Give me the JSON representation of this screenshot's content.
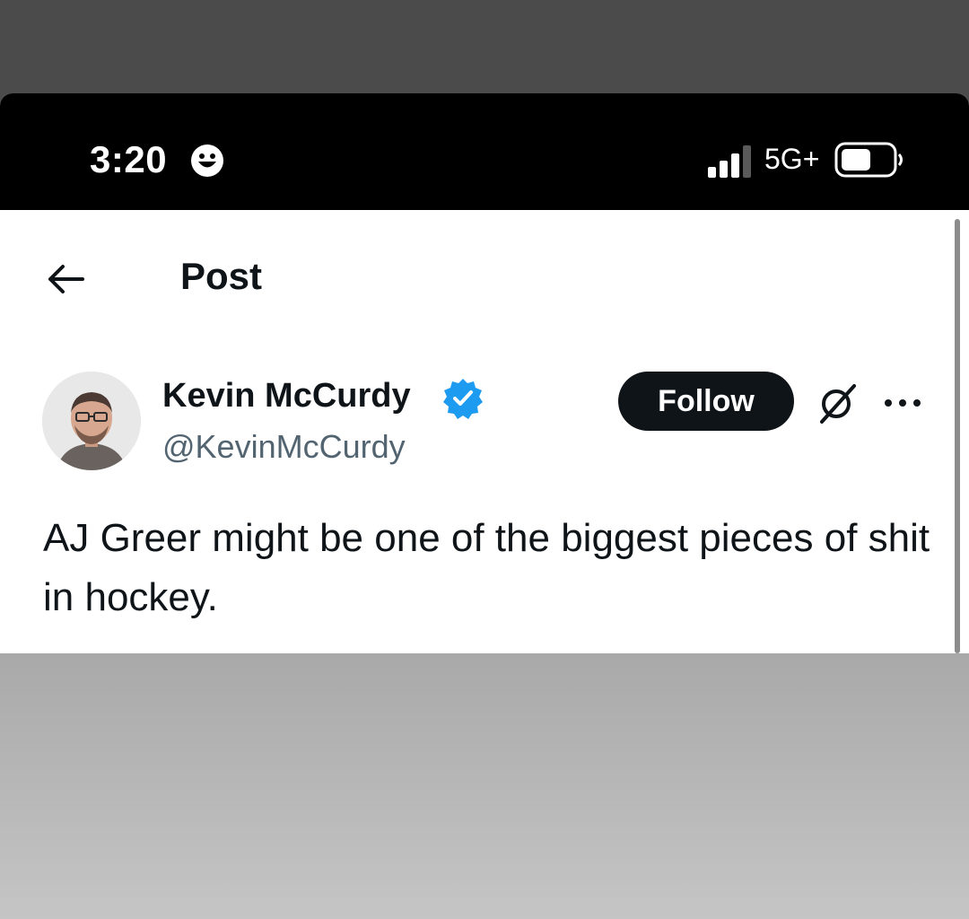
{
  "status_bar": {
    "time": "3:20",
    "network": "5G+",
    "icons": [
      "smiley-icon",
      "signal-icon",
      "battery-icon"
    ]
  },
  "header": {
    "back_icon": "back-arrow-icon",
    "title": "Post"
  },
  "author": {
    "display_name": "Kevin McCurdy",
    "handle": "@KevinMcCurdy",
    "verified_icon": "verified-badge-icon"
  },
  "actions": {
    "follow_label": "Follow",
    "grok_icon": "grok-icon",
    "more_icon": "more-icon"
  },
  "post": {
    "text": "AJ Greer might be one of the biggest pieces of shit in hockey."
  },
  "colors": {
    "verified_blue": "#1d9bf0",
    "text_primary": "#0f1419",
    "text_secondary": "#536471"
  }
}
